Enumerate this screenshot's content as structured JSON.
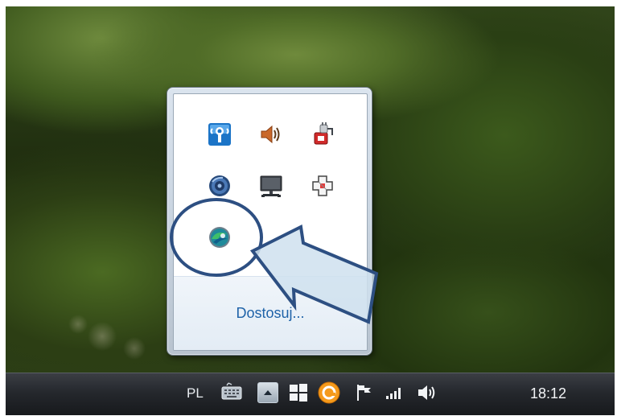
{
  "tray_popup": {
    "icons": [
      {
        "name": "wifi-signal-icon"
      },
      {
        "name": "speaker-volume-icon"
      },
      {
        "name": "power-plug-icon"
      },
      {
        "name": "blue-disc-icon"
      },
      {
        "name": "monitor-network-icon"
      },
      {
        "name": "puzzle-piece-icon"
      },
      {
        "name": "swirl-app-icon"
      }
    ],
    "customize_label": "Dostosuj..."
  },
  "taskbar": {
    "language": "PL",
    "clock": "18:12"
  },
  "colors": {
    "link_blue": "#1e62a8",
    "annotation_blue": "#2d4f82",
    "arrow_fill": "#cfe0ee"
  }
}
